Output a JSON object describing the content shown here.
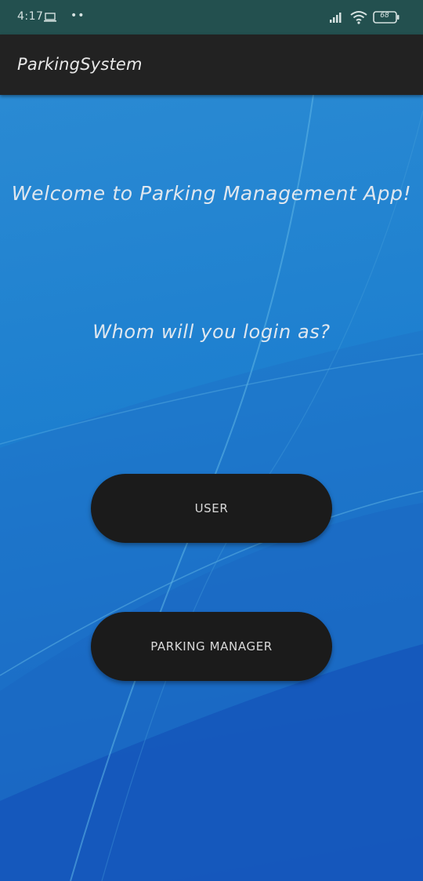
{
  "status_bar": {
    "time": "4:17",
    "notification_dots": "••",
    "icons": [
      "laptop-icon",
      "signal-icon",
      "wifi-icon",
      "battery-icon"
    ],
    "battery_level": "68"
  },
  "app_bar": {
    "title": "ParkingSystem"
  },
  "main": {
    "welcome": "Welcome to Parking Management App!",
    "question": "Whom will you login as?",
    "buttons": {
      "user_label": "USER",
      "manager_label": "PARKING MANAGER"
    }
  },
  "colors": {
    "status_bar": "#23504f",
    "app_bar": "#222222",
    "background_blue": "#1f7fd0",
    "button": "#1b1b1b",
    "text": "#dfe7ef"
  }
}
